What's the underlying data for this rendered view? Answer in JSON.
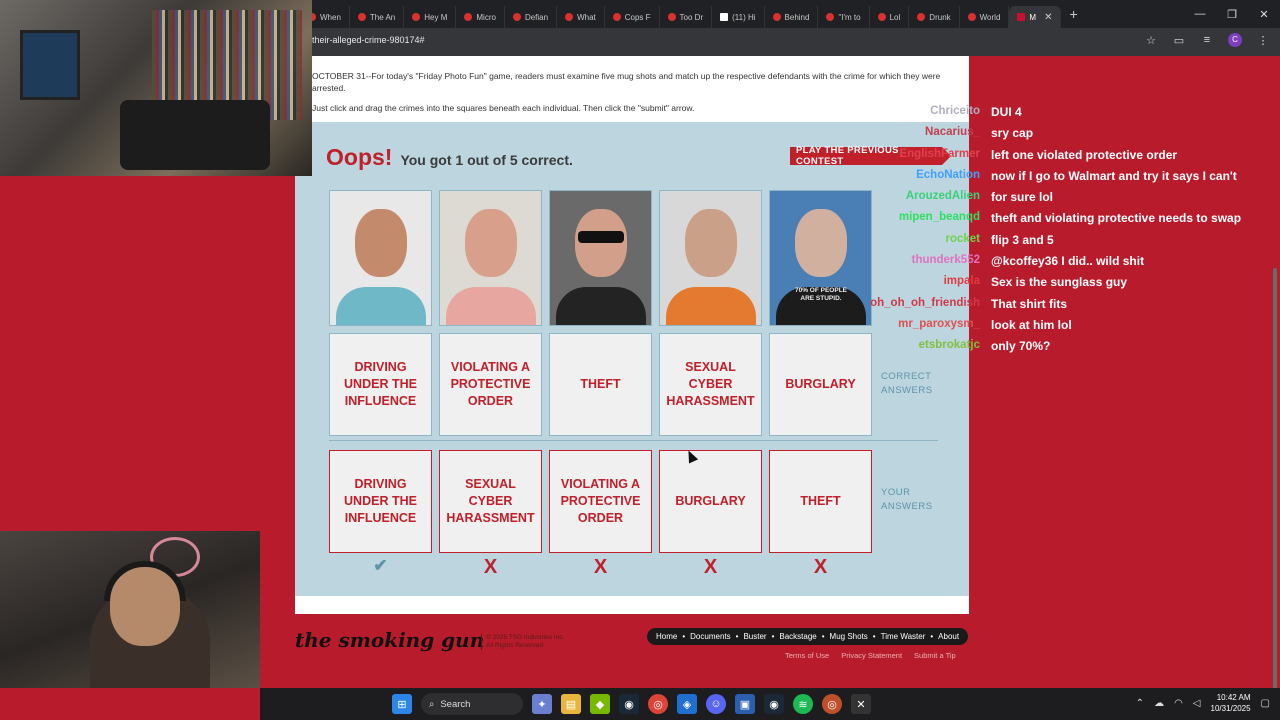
{
  "browser": {
    "tabs": [
      {
        "label": "When"
      },
      {
        "label": "The An"
      },
      {
        "label": "Hey M"
      },
      {
        "label": "Micro"
      },
      {
        "label": "Defian"
      },
      {
        "label": "What"
      },
      {
        "label": "Cops F"
      },
      {
        "label": "Too Dr"
      },
      {
        "label": "(11) Hi"
      },
      {
        "label": "Behind"
      },
      {
        "label": "\"I'm to"
      },
      {
        "label": "Lol"
      },
      {
        "label": "Drunk"
      },
      {
        "label": "World"
      },
      {
        "label": "M"
      }
    ],
    "url": "their-alleged-crime-980174#",
    "profile_initial": "C"
  },
  "article": {
    "intro": "OCTOBER 31--For today's \"Friday Photo Fun\" game, readers must examine five mug shots and match up the respective defendants with the crime for which they were arrested.",
    "instructions": "Just click and drag the crimes into the squares beneath each individual. Then click the \"submit\" arrow."
  },
  "game": {
    "result_word": "Oops!",
    "result_score": "You got 1 out of 5 correct.",
    "previous_button": "PLAY THE PREVIOUS CONTEST",
    "shirt_text": "70% OF PEOPLE ARE STUPID.",
    "correct_label": "CORRECT ANSWERS",
    "yours_label": "YOUR ANSWERS",
    "correct_answers": [
      "DRIVING UNDER THE INFLUENCE",
      "VIOLATING A PROTECTIVE ORDER",
      "THEFT",
      "SEXUAL CYBER HARASSMENT",
      "BURGLARY"
    ],
    "your_answers": [
      "DRIVING UNDER THE INFLUENCE",
      "SEXUAL CYBER HARASSMENT",
      "VIOLATING A PROTECTIVE ORDER",
      "BURGLARY",
      "THEFT"
    ],
    "marks": [
      "✔",
      "X",
      "X",
      "X",
      "X"
    ]
  },
  "footer": {
    "logo": "the smoking gun",
    "copyright_1": "© 2025 TSG Industries Inc.",
    "copyright_2": "All Rights Reserved.",
    "nav": [
      "Home",
      "Documents",
      "Buster",
      "Backstage",
      "Mug Shots",
      "Time Waster",
      "About"
    ],
    "sublinks": [
      "Terms of Use",
      "Privacy Statement",
      "Submit a Tip"
    ]
  },
  "chat": [
    {
      "user": "Chriceito",
      "text": "DUI 4",
      "color": "#b0b0c0"
    },
    {
      "user": "Nacarius_",
      "text": "sry cap",
      "color": "#c04050"
    },
    {
      "user": "EnglishFarmer",
      "text": "left one violated protective order",
      "color": "#e04050"
    },
    {
      "user": "EchoNation",
      "text": "now if I go to Walmart and try it says I can't",
      "color": "#3fa0ff"
    },
    {
      "user": "ArouzedAlien",
      "text": "for sure lol",
      "color": "#3ad07a"
    },
    {
      "user": "mipen_beanqd",
      "text": "theft and violating protective needs to swap",
      "color": "#2ee060"
    },
    {
      "user": "rocket",
      "text": "flip 3 and 5",
      "color": "#6fd24a"
    },
    {
      "user": "thunderk552",
      "text": "@kcoffey36 I did.. wild shit",
      "color": "#e070c0"
    },
    {
      "user": "impala",
      "text": "Sex is the sunglass guy",
      "color": "#e03a40"
    },
    {
      "user": "oh_oh_oh_friendish",
      "text": "That shirt fits",
      "color": "#d03848"
    },
    {
      "user": "mr_paroxysm_",
      "text": "look at him lol",
      "color": "#e05050"
    },
    {
      "user": "etsbrokatjc",
      "text": "only 70%?",
      "color": "#80c040"
    }
  ],
  "taskbar": {
    "search_label": "Search",
    "time": "10:42 AM",
    "date": "10/31/2025"
  }
}
